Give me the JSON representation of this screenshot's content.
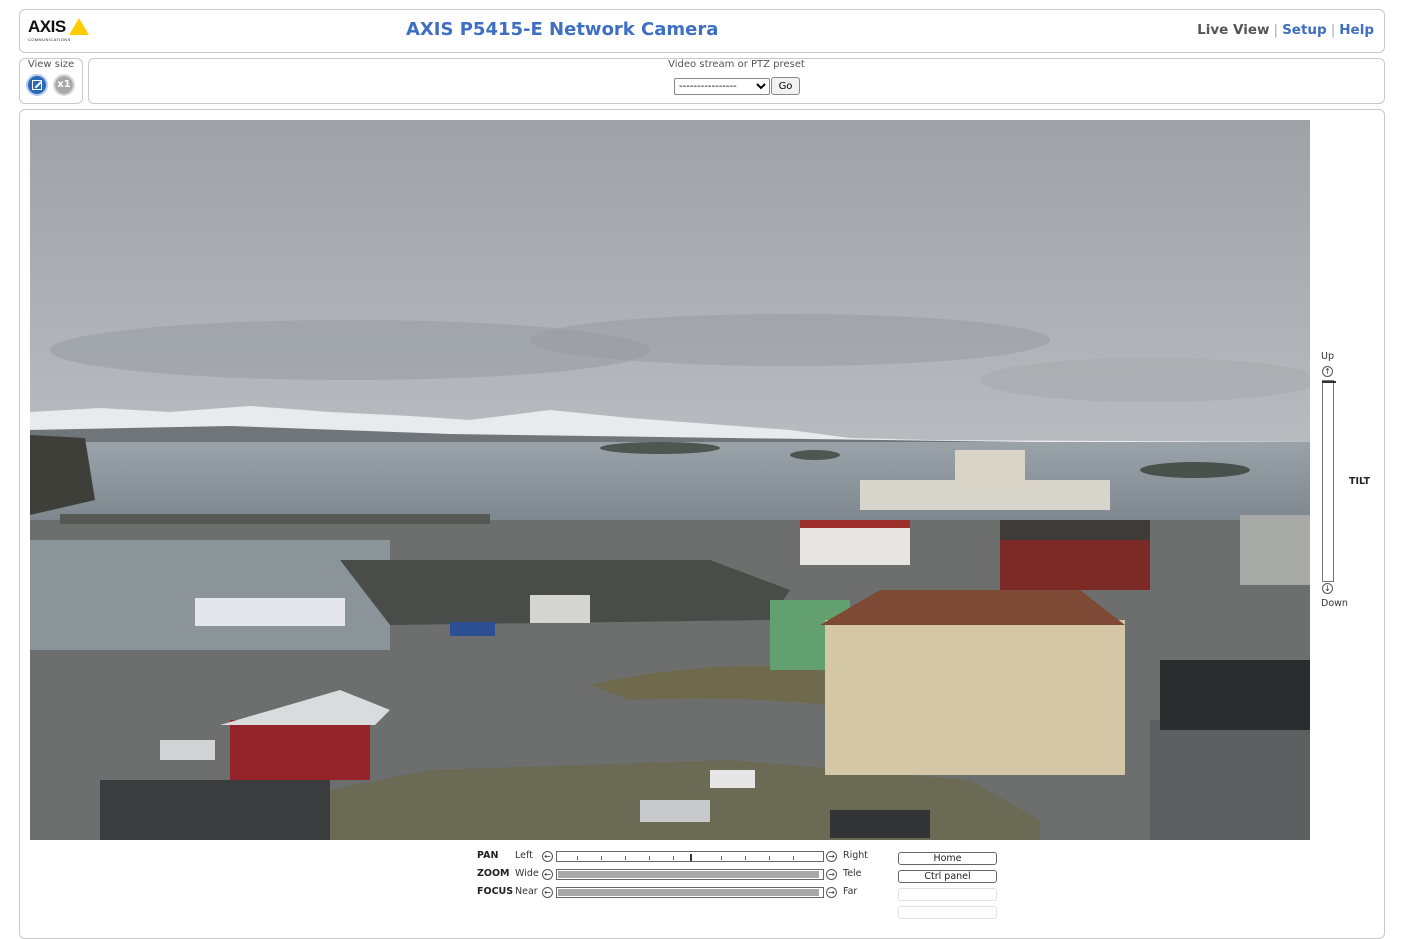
{
  "header": {
    "logo_text": "AXIS",
    "logo_subtext": "COMMUNICATIONS",
    "title": "AXIS P5415-E Network Camera",
    "nav": {
      "live_view": "Live View",
      "setup": "Setup",
      "help": "Help"
    }
  },
  "view_size": {
    "label": "View size",
    "x1_label": "x1"
  },
  "stream": {
    "label": "Video stream or PTZ preset",
    "selected": "----------------",
    "go_label": "Go"
  },
  "tilt": {
    "label": "TILT",
    "up_label": "Up",
    "down_label": "Down"
  },
  "controls": {
    "pan": {
      "name": "PAN",
      "low": "Left",
      "high": "Right"
    },
    "zoom": {
      "name": "ZOOM",
      "low": "Wide",
      "high": "Tele"
    },
    "focus": {
      "name": "FOCUS",
      "low": "Near",
      "high": "Far"
    }
  },
  "side_buttons": {
    "home": "Home",
    "ctrl_panel": "Ctrl panel"
  },
  "colors": {
    "title_blue": "#3e6fc2",
    "logo_yellow": "#ffcc00",
    "fit_button_blue": "#2a68b8"
  },
  "icons": [
    "fit-view-icon",
    "arrow-up-icon",
    "arrow-down-icon",
    "arrow-left-icon",
    "arrow-right-icon"
  ]
}
